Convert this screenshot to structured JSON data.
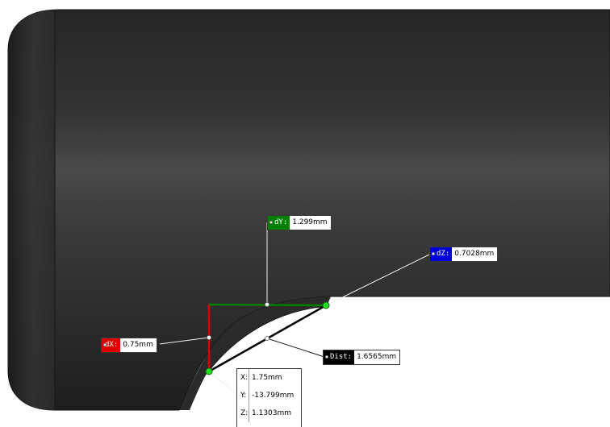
{
  "measurements": {
    "dX": {
      "label": "dX:",
      "value": "0.75mm",
      "color": "#e00000"
    },
    "dY": {
      "label": "dY:",
      "value": "1.299mm",
      "color": "#008000"
    },
    "dZ": {
      "label": "dZ:",
      "value": "0.7028mm",
      "color": "#0000d8"
    },
    "dist": {
      "label": "Dist:",
      "value": "1.6565mm",
      "color": "#000000"
    }
  },
  "point_coordinates": {
    "x_label": "X:",
    "x_value": "1.75mm",
    "y_label": "Y:",
    "y_value": "-13.799mm",
    "z_label": "Z:",
    "z_value": "1.1303mm"
  },
  "colors": {
    "model_body": "#2e2e2e",
    "model_highlight": "#5a5a5a",
    "measure_x": "#e00000",
    "measure_y": "#008000",
    "measure_z": "#0000d8",
    "point_marker": "#22dd22"
  }
}
